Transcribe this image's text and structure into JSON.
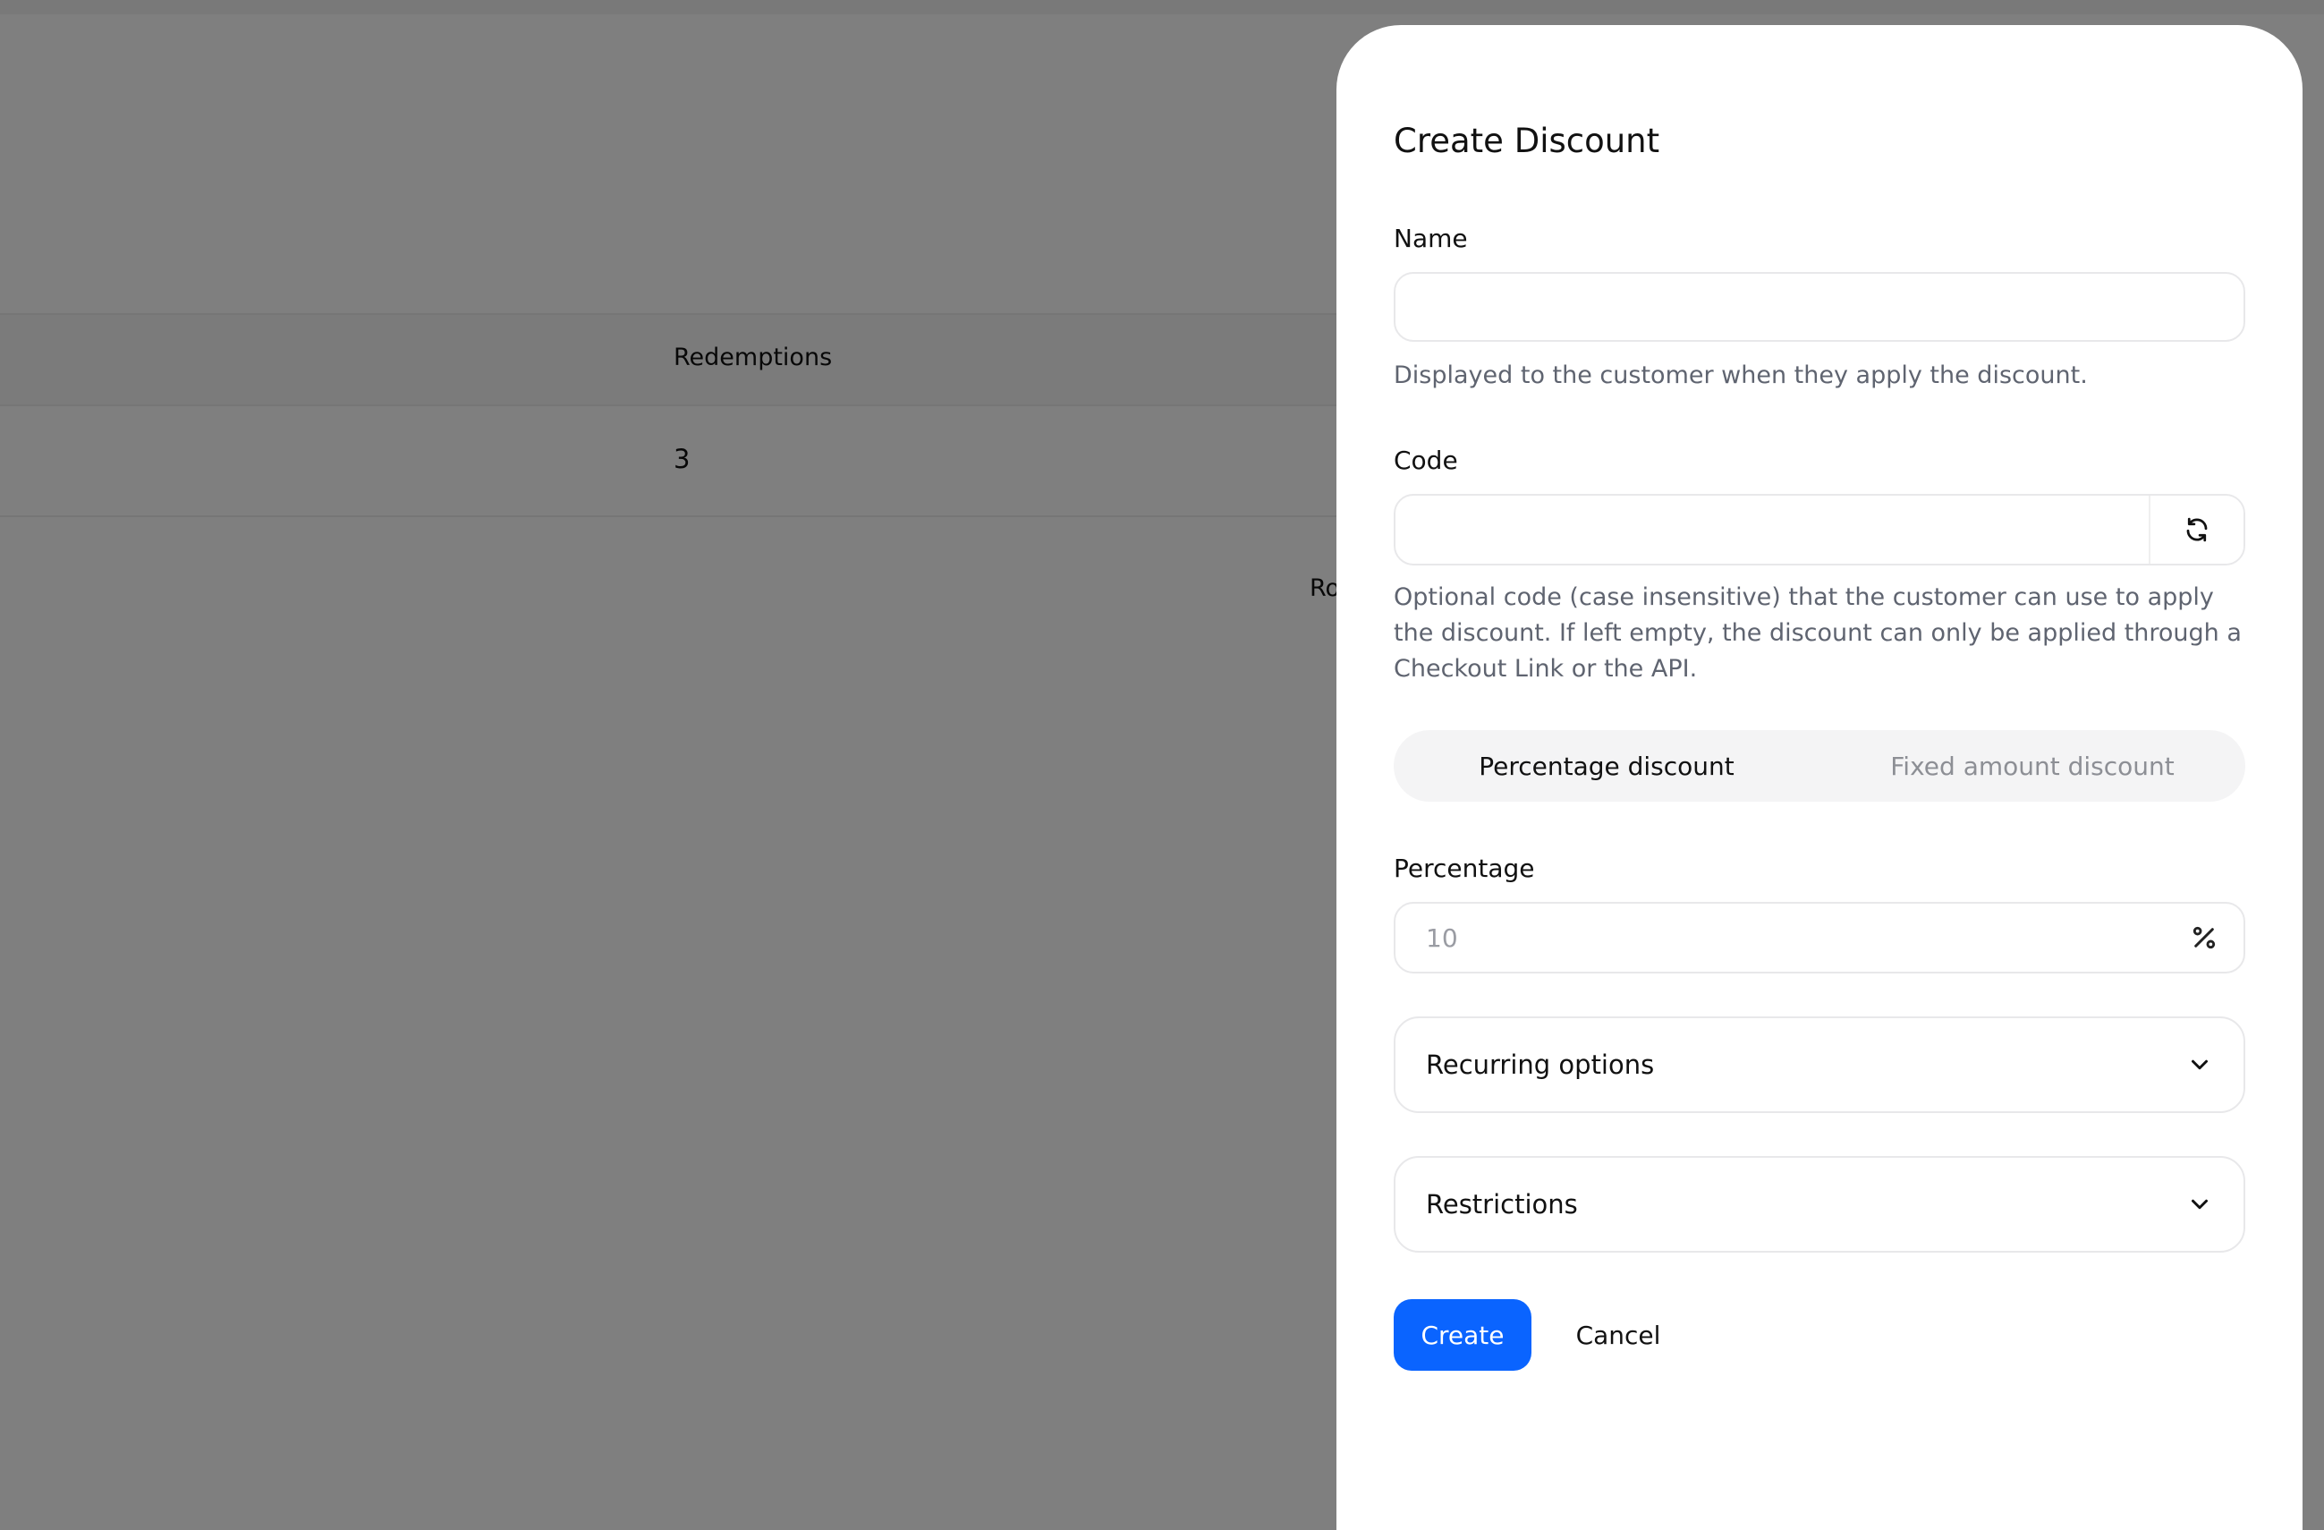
{
  "background": {
    "table": {
      "header": "Redemptions",
      "row_value": "3"
    },
    "rows_text_fragment": "Ro"
  },
  "modal": {
    "title": "Create Discount",
    "name": {
      "label": "Name",
      "value": "",
      "placeholder": "",
      "help": "Displayed to the customer when they apply the discount."
    },
    "code": {
      "label": "Code",
      "value": "",
      "placeholder": "",
      "help": "Optional code (case insensitive) that the customer can use to apply the discount. If left empty, the discount can only be applied through a Checkout Link or the API.",
      "regenerate_icon": "refresh-icon"
    },
    "discount_type": {
      "options": [
        "Percentage discount",
        "Fixed amount discount"
      ],
      "selected": "Percentage discount"
    },
    "percentage": {
      "label": "Percentage",
      "value": "",
      "placeholder": "10",
      "suffix_icon": "percent-icon"
    },
    "recurring": {
      "label": "Recurring options",
      "icon": "chevron-down-icon"
    },
    "restrictions": {
      "label": "Restrictions",
      "icon": "chevron-down-icon"
    },
    "actions": {
      "create": "Create",
      "cancel": "Cancel"
    }
  },
  "colors": {
    "primary": "#0a64ff",
    "overlay": "#808080",
    "help_text": "#5f6470"
  }
}
